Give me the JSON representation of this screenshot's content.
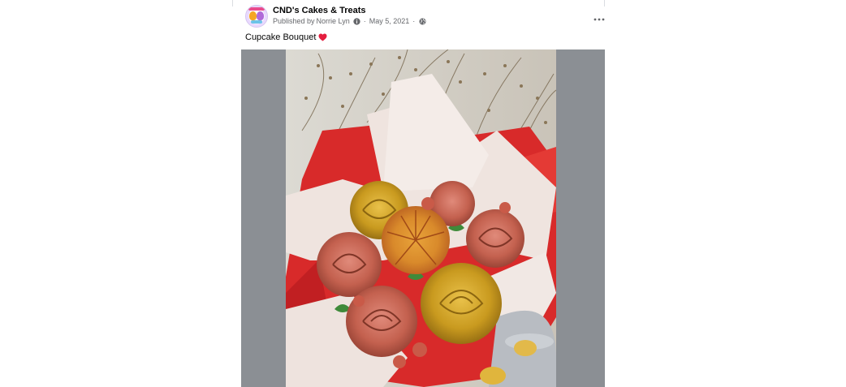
{
  "post": {
    "page_name": "CND's Cakes & Treats",
    "published_by_prefix": "Published by",
    "author": "Norrie Lyn",
    "date": "May 5, 2021",
    "separator": "·",
    "caption": "Cupcake Bouquet",
    "caption_emoji_icon": "red-heart-icon",
    "privacy_icon": "globe-icon",
    "info_icon": "info-icon",
    "menu_icon": "more-options-icon",
    "photo_description": "cupcake-bouquet-photo"
  },
  "colors": {
    "text_primary": "#050505",
    "text_secondary": "#65676b",
    "media_background": "#8b8f94",
    "heart": "#e41e3f"
  }
}
